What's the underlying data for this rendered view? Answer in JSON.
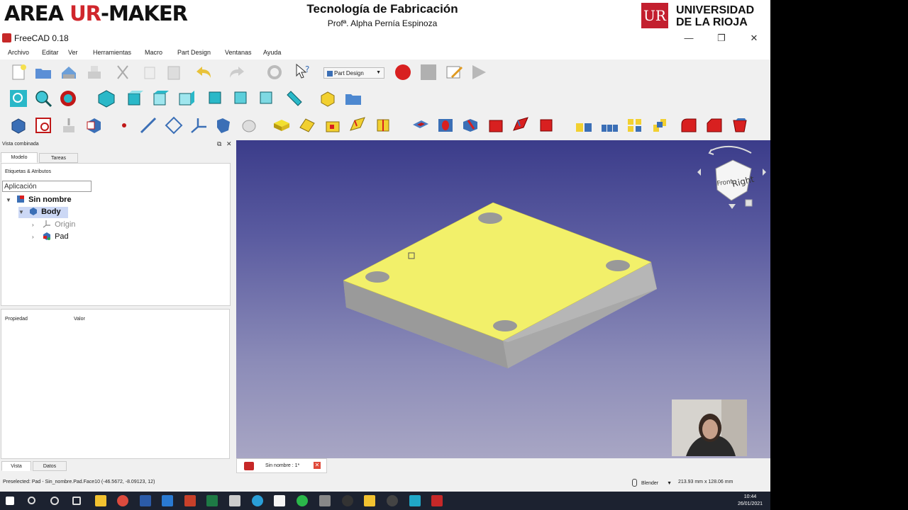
{
  "banner": {
    "logo_left": "AREA UR-MAKER",
    "title": "Tecnología de Fabricación",
    "subtitle": "Profª. Alpha Pernía Espinoza",
    "university_line1": "UNIVERSIDAD",
    "university_line2": "DE LA RIOJA"
  },
  "window": {
    "title": "FreeCAD 0.18",
    "minimize": "—",
    "maximize": "❐",
    "close": "✕"
  },
  "menu": {
    "items": [
      "Archivo",
      "Editar",
      "Ver",
      "Herramientas",
      "Macro",
      "Part Design",
      "Ventanas",
      "Ayuda"
    ]
  },
  "toolbar": {
    "workbench": "Part Design"
  },
  "combo": {
    "title": "Vista combinada",
    "tabs": [
      "Modelo",
      "Tareas"
    ],
    "labels_header": "Etiquetas & Atributos",
    "app_label": "Aplicación",
    "tree": [
      {
        "label": "Sin nombre",
        "icon": "document-icon"
      },
      {
        "label": "Body",
        "icon": "body-icon"
      },
      {
        "label": "Origin",
        "icon": "origin-icon"
      },
      {
        "label": "Pad",
        "icon": "pad-icon"
      }
    ],
    "property_header": "Propiedad",
    "value_header": "Valor",
    "bottom_tabs": [
      "Vista",
      "Datos"
    ]
  },
  "navcube": {
    "face_front": "Front",
    "face_right": "Right"
  },
  "doc_tab": {
    "label": "Sin nombre : 1*"
  },
  "status": {
    "preselected": "Preselected: Pad - Sin_nombre.Pad.Face10 (-46.5672, -8.09123, 12)",
    "nav_style": "Blender",
    "dimensions": "213.93 mm x 128.06 mm"
  },
  "taskbar": {
    "time": "10:44",
    "date": "26/01/2021"
  },
  "colors": {
    "part_face": "#f2f06a",
    "part_side": "#a8a8a8",
    "view_top": "#3b3c8a",
    "view_bottom": "#a8a6c4"
  }
}
